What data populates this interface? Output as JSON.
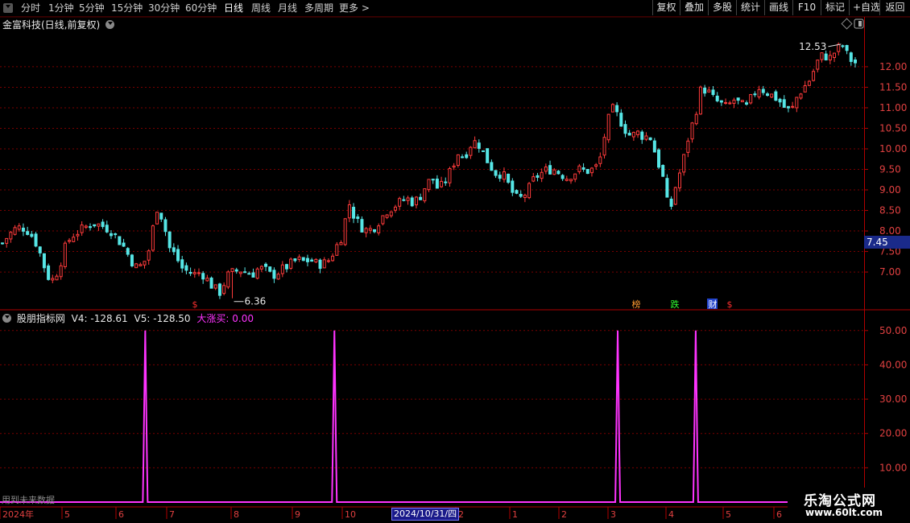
{
  "toolbar": {
    "left_items": [
      {
        "label": "分时",
        "active": false
      },
      {
        "label": "1分钟",
        "active": false
      },
      {
        "label": "5分钟",
        "active": false
      },
      {
        "label": "15分钟",
        "active": false
      },
      {
        "label": "30分钟",
        "active": false
      },
      {
        "label": "60分钟",
        "active": false
      },
      {
        "label": "日线",
        "active": true
      },
      {
        "label": "周线",
        "active": false
      },
      {
        "label": "月线",
        "active": false
      },
      {
        "label": "多周期",
        "active": false
      },
      {
        "label": "更多 >",
        "active": false
      }
    ],
    "right_buttons": [
      "复权",
      "叠加",
      "多股",
      "统计",
      "画线",
      "F10",
      "标记",
      "+自选",
      "返回"
    ]
  },
  "stock": {
    "title": "金富科技(日线,前复权)",
    "current_price": "7.45",
    "high_label": "12.53",
    "low_label": "6.36"
  },
  "indicator": {
    "name": "股朋指标网",
    "v4": "V4: -128.61",
    "v5": "V5: -128.50",
    "dzm": "大涨买: 0.00"
  },
  "markers": [
    {
      "text": "$",
      "color": "#ff3030"
    },
    {
      "text": "榜",
      "color": "#ff9a30"
    },
    {
      "text": "跌",
      "color": "#30ff30"
    },
    {
      "text": "财",
      "color": "#ffffff"
    },
    {
      "text": "$",
      "color": "#ff3030"
    }
  ],
  "footer": {
    "future_note": "用到未来数据",
    "date_tag": "2024/10/31/四",
    "year_label": "2024年",
    "watermark_title": "乐淘公式网",
    "watermark_url": "www.60lt.com"
  },
  "colors": {
    "up": "#ff3b3b",
    "down": "#56e6e6",
    "indicator": "#ff33ff",
    "grid": "#7a0000",
    "axis": "#b00000"
  },
  "chart_data": [
    {
      "type": "candlestick",
      "title": "金富科技(日线,前复权)",
      "y_ticks": [
        7.0,
        7.5,
        8.0,
        8.5,
        9.0,
        9.5,
        10.0,
        10.5,
        11.0,
        11.5,
        12.0
      ],
      "ylim": [
        6.1,
        12.9
      ],
      "high": 12.53,
      "low": 6.36,
      "last": 7.45,
      "month_labels": [
        "2024年",
        "5",
        "6",
        "7",
        "8",
        "9",
        "10",
        "2024/10/31/四",
        "2",
        "1",
        "2",
        "3",
        "4",
        "5",
        "6"
      ],
      "close_path": [
        7.7,
        7.9,
        8.05,
        8.1,
        8.0,
        7.8,
        7.4,
        6.9,
        6.8,
        7.2,
        7.7,
        7.9,
        8.0,
        8.1,
        8.2,
        8.15,
        8.1,
        8.0,
        7.8,
        7.6,
        7.3,
        7.1,
        7.2,
        7.6,
        8.6,
        8.3,
        7.6,
        7.4,
        7.1,
        7.0,
        6.95,
        7.0,
        6.8,
        6.6,
        6.5,
        6.9,
        7.0,
        7.05,
        7.0,
        6.95,
        7.1,
        7.05,
        6.9,
        7.0,
        7.1,
        7.2,
        7.3,
        7.25,
        7.3,
        7.2,
        7.2,
        7.3,
        7.6,
        7.9,
        8.7,
        8.3,
        8.1,
        8.0,
        8.1,
        8.3,
        8.5,
        8.6,
        8.7,
        8.8,
        8.7,
        8.8,
        9.1,
        9.3,
        9.0,
        9.2,
        9.5,
        9.9,
        9.8,
        10.1,
        10.2,
        9.9,
        9.6,
        9.4,
        9.4,
        9.1,
        8.8,
        8.8,
        9.0,
        9.3,
        9.4,
        9.5,
        9.5,
        9.4,
        9.3,
        9.4,
        9.5,
        9.45,
        9.5,
        9.6,
        10.4,
        11.0,
        10.8,
        10.5,
        10.3,
        10.4,
        10.3,
        10.3,
        9.8,
        9.3,
        8.4,
        9.1,
        9.6,
        10.3,
        10.8,
        11.5,
        11.4,
        11.2,
        11.1,
        11.0,
        11.2,
        11.1,
        11.0,
        11.3,
        11.5,
        11.4,
        11.3,
        11.2,
        11.0,
        10.9,
        11.3,
        11.5,
        11.7,
        12.1,
        12.3,
        12.2,
        12.4,
        12.53,
        12.2,
        12.1
      ]
    },
    {
      "type": "line",
      "title": "股朋指标网",
      "series": [
        {
          "name": "大涨买",
          "spikes_at_fraction": [
            0.162,
            0.373,
            0.689,
            0.776
          ],
          "spike_value": 50.0,
          "baseline": 0.0
        }
      ],
      "y_ticks": [
        10.0,
        20.0,
        30.0,
        40.0,
        50.0
      ],
      "ylim": [
        0,
        53
      ]
    }
  ]
}
